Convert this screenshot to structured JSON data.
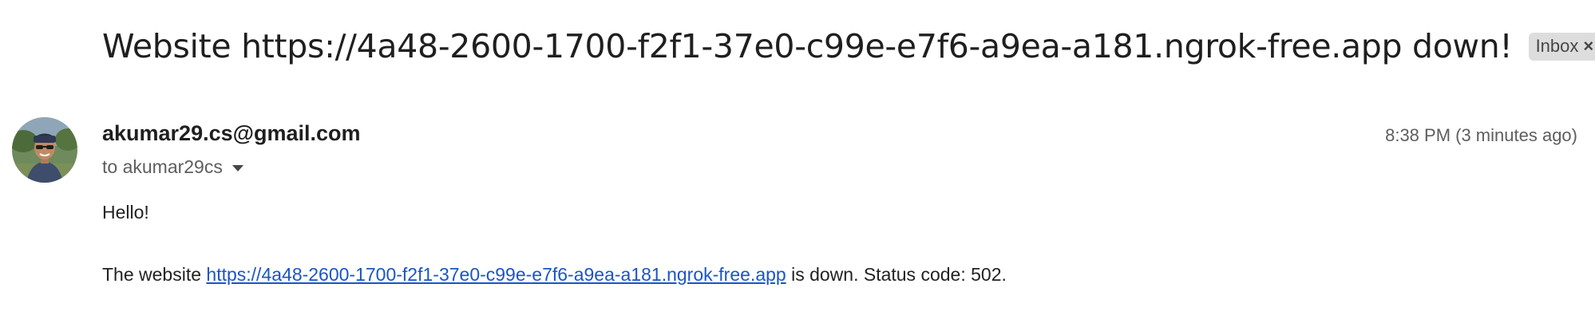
{
  "email": {
    "subject": "Website https://4a48-2600-1700-f2f1-37e0-c99e-e7f6-a9ea-a181.ngrok-free.app down!",
    "label": "Inbox",
    "label_close": "×",
    "sender": "akumar29.cs@gmail.com",
    "recipient": "to akumar29cs",
    "timestamp": "8:38 PM (3 minutes ago)",
    "body": {
      "greeting": "Hello!",
      "line_prefix": "The website ",
      "link_text": "https://4a48-2600-1700-f2f1-37e0-c99e-e7f6-a9ea-a181.ngrok-free.app",
      "line_suffix": " is down. Status code: 502."
    }
  },
  "colors": {
    "link": "#1a55c8",
    "chip_bg": "#dddddd",
    "secondary_text": "#5e5e5e"
  },
  "icons": {
    "recipient_dropdown": "chevron-down-icon",
    "avatar": "sender-avatar"
  }
}
